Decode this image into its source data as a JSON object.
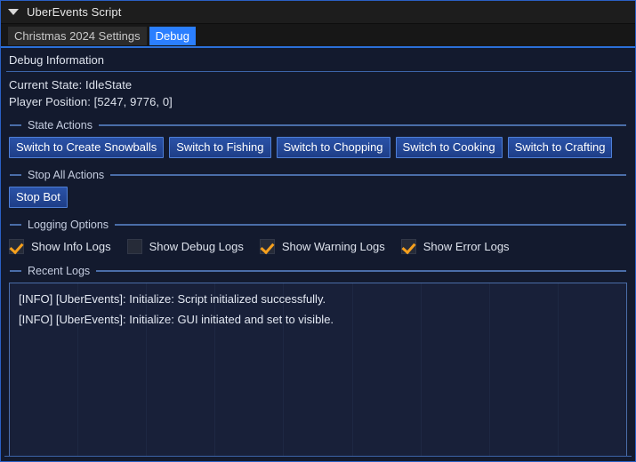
{
  "window": {
    "title": "UberEvents Script",
    "foldout_icon": "triangle-down-icon",
    "accent_color": "#2b7fff",
    "border_color": "#2a5fc4",
    "background_color": "#131a2e",
    "titlebar_color": "#1d1d1d"
  },
  "tabs": [
    {
      "label": "Christmas 2024 Settings",
      "active": false
    },
    {
      "label": "Debug",
      "active": true
    }
  ],
  "debug_information": {
    "header": "Debug Information",
    "current_state": "Current State: IdleState",
    "player_position": "Player Position: [5247, 9776, 0]"
  },
  "state_actions": {
    "group_label": "State Actions",
    "buttons": [
      "Switch to Create Snowballs",
      "Switch to Fishing",
      "Switch to Chopping",
      "Switch to Cooking",
      "Switch to Crafting"
    ]
  },
  "stop_all_actions": {
    "group_label": "Stop All Actions",
    "buttons": [
      "Stop Bot"
    ]
  },
  "logging_options": {
    "group_label": "Logging Options",
    "checkbox_color": "#f6a01d",
    "items": [
      {
        "label": "Show Info Logs",
        "checked": true
      },
      {
        "label": "Show Debug Logs",
        "checked": false
      },
      {
        "label": "Show Warning Logs",
        "checked": true
      },
      {
        "label": "Show Error Logs",
        "checked": true
      }
    ]
  },
  "recent_logs": {
    "group_label": "Recent Logs",
    "lines": [
      "[INFO] [UberEvents]: Initialize: Script initialized successfully.",
      "[INFO] [UberEvents]: Initialize: GUI initiated and set to visible."
    ]
  }
}
